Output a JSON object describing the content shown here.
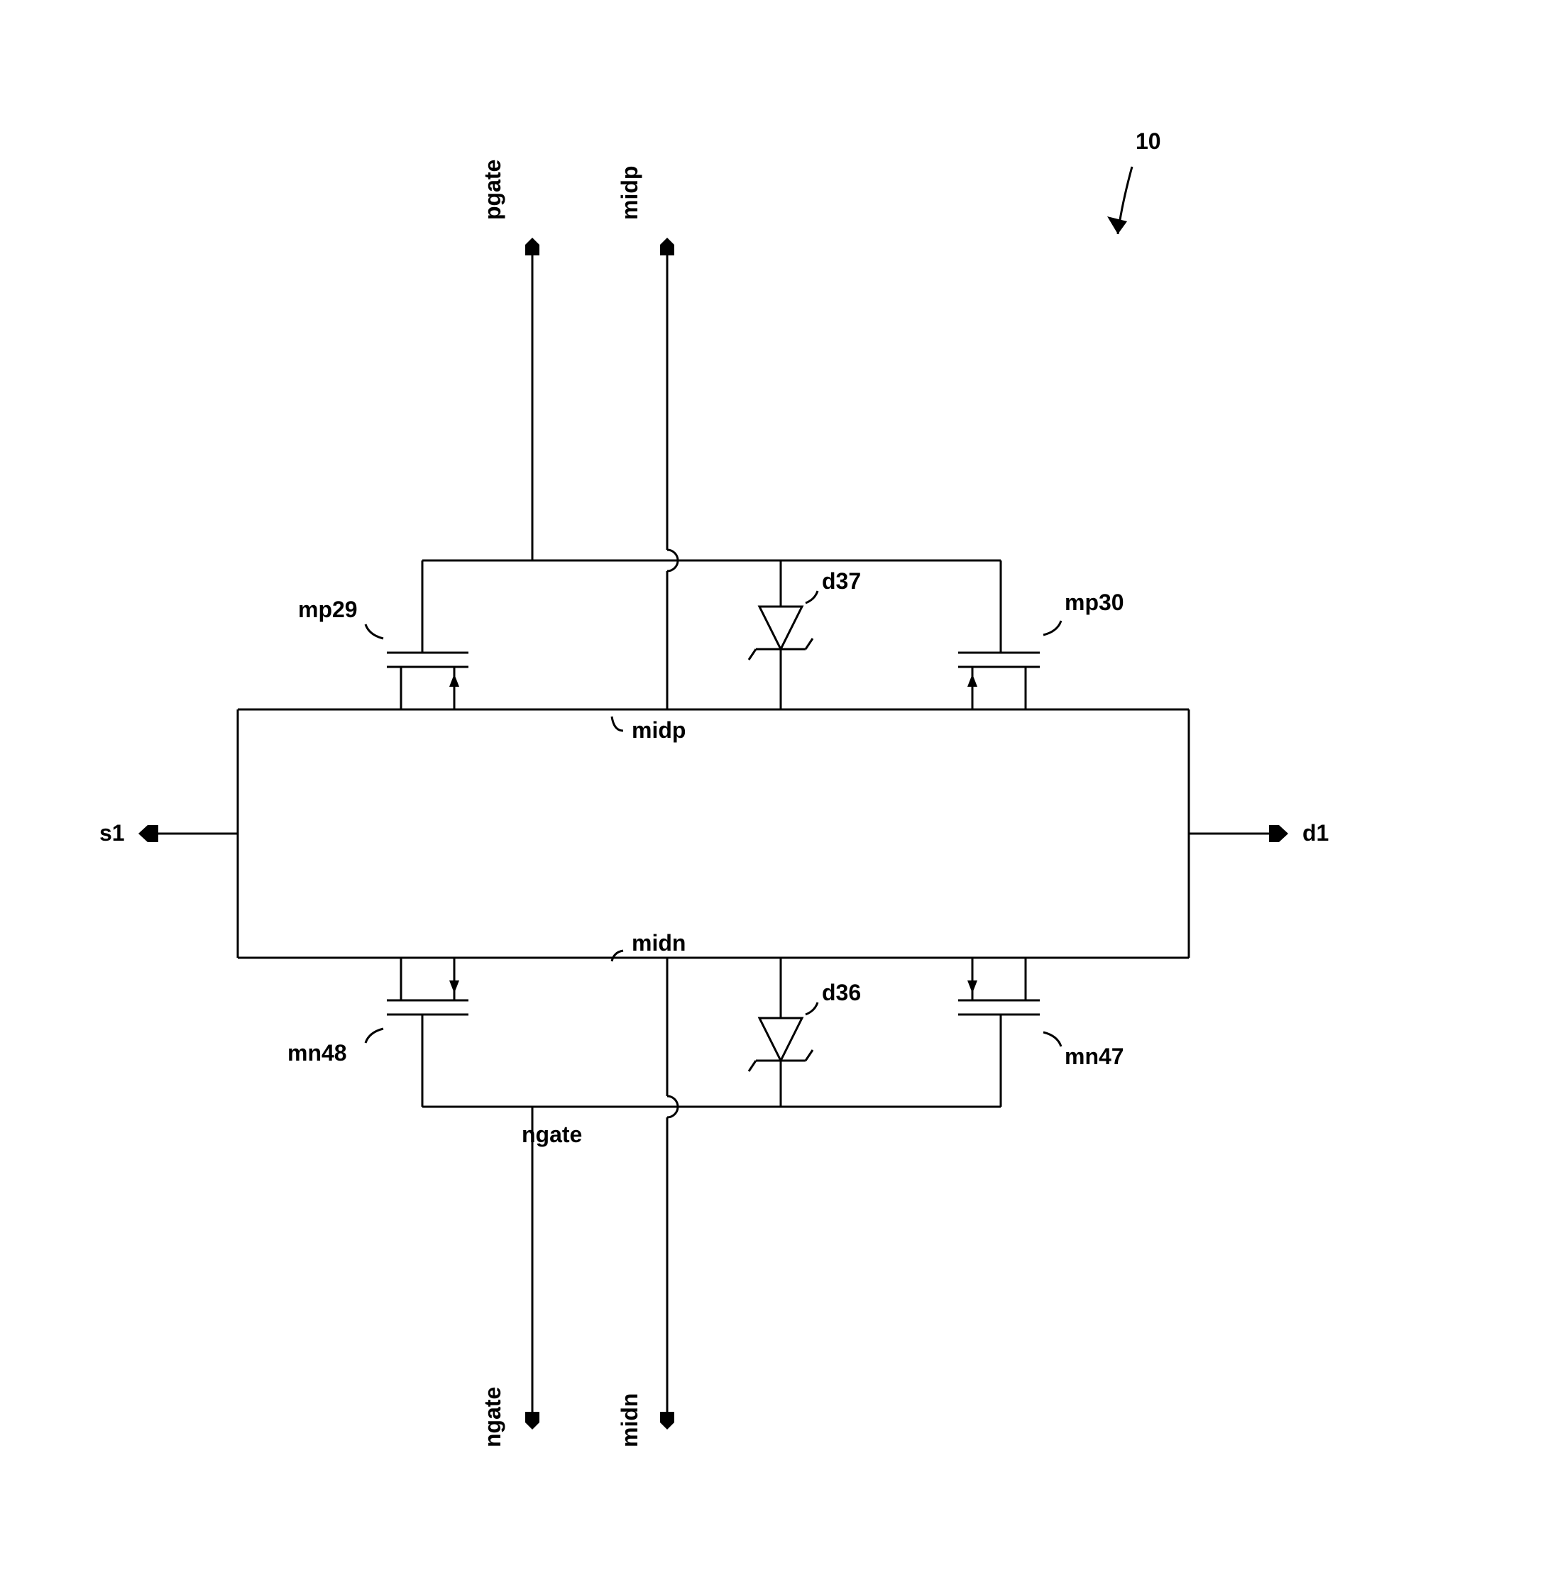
{
  "figure_number": "10",
  "terminals": {
    "left": "s1",
    "right": "d1",
    "top_left": "pgate",
    "top_right": "midp",
    "bottom_left": "ngate",
    "bottom_right": "midn"
  },
  "transistors": {
    "top_left": "mp29",
    "top_right": "mp30",
    "bottom_left": "mn48",
    "bottom_right": "mn47"
  },
  "diodes": {
    "top": "d37",
    "bottom": "d36"
  },
  "nets": {
    "upper": "midp",
    "lower": "midn",
    "ngate_label": "ngate"
  }
}
